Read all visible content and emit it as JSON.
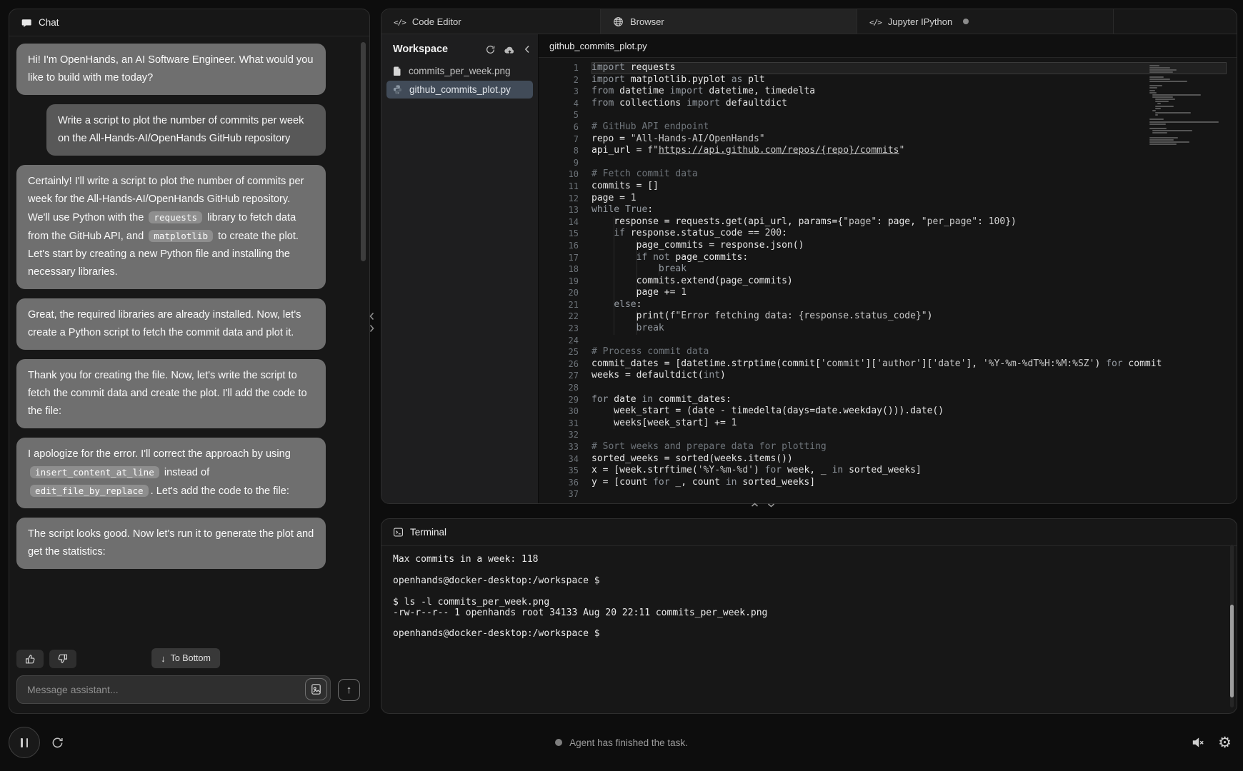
{
  "chat": {
    "title": "Chat",
    "messages": [
      {
        "role": "assistant",
        "parts": [
          {
            "t": "text",
            "v": "Hi! I'm OpenHands, an AI Software Engineer. What would you like to build with me today?"
          }
        ]
      },
      {
        "role": "user",
        "parts": [
          {
            "t": "text",
            "v": "Write a script to plot the number of commits per week on the All-Hands-AI/OpenHands GitHub repository"
          }
        ]
      },
      {
        "role": "assistant",
        "parts": [
          {
            "t": "text",
            "v": "Certainly! I'll write a script to plot the number of commits per week for the All-Hands-AI/OpenHands GitHub repository. We'll use Python with the "
          },
          {
            "t": "code",
            "v": "requests"
          },
          {
            "t": "text",
            "v": " library to fetch data from the GitHub API, and "
          },
          {
            "t": "code",
            "v": "matplotlib"
          },
          {
            "t": "text",
            "v": " to create the plot. Let's start by creating a new Python file and installing the necessary libraries."
          }
        ]
      },
      {
        "role": "assistant",
        "parts": [
          {
            "t": "text",
            "v": "Great, the required libraries are already installed. Now, let's create a Python script to fetch the commit data and plot it."
          }
        ]
      },
      {
        "role": "assistant",
        "parts": [
          {
            "t": "text",
            "v": "Thank you for creating the file. Now, let's write the script to fetch the commit data and create the plot. I'll add the code to the file:"
          }
        ]
      },
      {
        "role": "assistant",
        "parts": [
          {
            "t": "text",
            "v": "I apologize for the error. I'll correct the approach by using "
          },
          {
            "t": "code",
            "v": "insert_content_at_line"
          },
          {
            "t": "text",
            "v": " instead of "
          },
          {
            "t": "code",
            "v": "edit_file_by_replace"
          },
          {
            "t": "text",
            "v": ". Let's add the code to the file:"
          }
        ]
      },
      {
        "role": "assistant",
        "parts": [
          {
            "t": "text",
            "v": "The script looks good. Now let's run it to generate the plot and get the statistics:"
          }
        ]
      }
    ],
    "to_bottom_label": "To Bottom",
    "input_placeholder": "Message assistant...",
    "feedback_icons": [
      "thumbs-up-icon",
      "thumbs-down-icon"
    ],
    "input_icons": [
      "attach-image-icon",
      "send-up-arrow-icon"
    ]
  },
  "tabs": [
    {
      "id": "code-editor",
      "label": "Code Editor",
      "icon": "code-icon",
      "dot": false
    },
    {
      "id": "browser",
      "label": "Browser",
      "icon": "globe-icon",
      "dot": false
    },
    {
      "id": "jupyter",
      "label": "Jupyter IPython",
      "icon": "code-icon",
      "dot": true
    }
  ],
  "workspace": {
    "title": "Workspace",
    "toolbar_icons": [
      "refresh-icon",
      "cloud-upload-icon",
      "collapse-left-icon"
    ],
    "files": [
      {
        "name": "commits_per_week.png",
        "icon": "image-file-icon",
        "selected": false
      },
      {
        "name": "github_commits_plot.py",
        "icon": "python-file-icon",
        "selected": true
      }
    ]
  },
  "editor": {
    "open_file": "github_commits_plot.py",
    "lines": [
      {
        "n": 1,
        "cur": true,
        "t": [
          [
            "kw",
            "import"
          ],
          [
            "pl",
            " requests"
          ]
        ]
      },
      {
        "n": 2,
        "t": [
          [
            "kw",
            "import"
          ],
          [
            "pl",
            " matplotlib.pyplot "
          ],
          [
            "kw",
            "as"
          ],
          [
            "pl",
            " plt"
          ]
        ]
      },
      {
        "n": 3,
        "t": [
          [
            "kw",
            "from"
          ],
          [
            "pl",
            " datetime "
          ],
          [
            "kw",
            "import"
          ],
          [
            "pl",
            " datetime, timedelta"
          ]
        ]
      },
      {
        "n": 4,
        "t": [
          [
            "kw",
            "from"
          ],
          [
            "pl",
            " collections "
          ],
          [
            "kw",
            "import"
          ],
          [
            "pl",
            " defaultdict"
          ]
        ]
      },
      {
        "n": 5,
        "t": []
      },
      {
        "n": 6,
        "t": [
          [
            "com",
            "# GitHub API endpoint"
          ]
        ]
      },
      {
        "n": 7,
        "t": [
          [
            "pl",
            "repo = "
          ],
          [
            "str",
            "\"All-Hands-AI/OpenHands\""
          ]
        ]
      },
      {
        "n": 8,
        "t": [
          [
            "pl",
            "api_url = "
          ],
          [
            "str",
            "f\""
          ],
          [
            "url",
            "https://api.github.com/repos/{repo}/commits"
          ],
          [
            "str",
            "\""
          ]
        ]
      },
      {
        "n": 9,
        "t": []
      },
      {
        "n": 10,
        "t": [
          [
            "com",
            "# Fetch commit data"
          ]
        ]
      },
      {
        "n": 11,
        "t": [
          [
            "pl",
            "commits = []"
          ]
        ]
      },
      {
        "n": 12,
        "t": [
          [
            "pl",
            "page = "
          ],
          [
            "num",
            "1"
          ]
        ]
      },
      {
        "n": 13,
        "t": [
          [
            "kw",
            "while"
          ],
          [
            "pl",
            " "
          ],
          [
            "kw",
            "True"
          ],
          [
            "pl",
            ":"
          ]
        ]
      },
      {
        "n": 14,
        "t": [
          [
            "pl",
            "    response = requests.get(api_url, params={"
          ],
          [
            "str",
            "\"page\""
          ],
          [
            "pl",
            ": page, "
          ],
          [
            "str",
            "\"per_page\""
          ],
          [
            "pl",
            ": "
          ],
          [
            "num",
            "100"
          ],
          [
            "pl",
            "})"
          ]
        ]
      },
      {
        "n": 15,
        "t": [
          [
            "pl",
            "    "
          ],
          [
            "kw",
            "if"
          ],
          [
            "pl",
            " response.status_code == "
          ],
          [
            "num",
            "200"
          ],
          [
            "pl",
            ":"
          ]
        ]
      },
      {
        "n": 16,
        "t": [
          [
            "pl",
            "        page_commits = response.json()"
          ]
        ]
      },
      {
        "n": 17,
        "t": [
          [
            "pl",
            "        "
          ],
          [
            "kw",
            "if"
          ],
          [
            "pl",
            " "
          ],
          [
            "kw",
            "not"
          ],
          [
            "pl",
            " page_commits:"
          ]
        ]
      },
      {
        "n": 18,
        "t": [
          [
            "pl",
            "            "
          ],
          [
            "kw",
            "break"
          ]
        ]
      },
      {
        "n": 19,
        "t": [
          [
            "pl",
            "        commits.extend(page_commits)"
          ]
        ]
      },
      {
        "n": 20,
        "t": [
          [
            "pl",
            "        page += "
          ],
          [
            "num",
            "1"
          ]
        ]
      },
      {
        "n": 21,
        "t": [
          [
            "pl",
            "    "
          ],
          [
            "kw",
            "else"
          ],
          [
            "pl",
            ":"
          ]
        ]
      },
      {
        "n": 22,
        "t": [
          [
            "pl",
            "        print("
          ],
          [
            "str",
            "f\"Error fetching data: {response.status_code}\""
          ],
          [
            "pl",
            ")"
          ]
        ]
      },
      {
        "n": 23,
        "t": [
          [
            "pl",
            "        "
          ],
          [
            "kw",
            "break"
          ]
        ]
      },
      {
        "n": 24,
        "t": []
      },
      {
        "n": 25,
        "t": [
          [
            "com",
            "# Process commit data"
          ]
        ]
      },
      {
        "n": 26,
        "t": [
          [
            "pl",
            "commit_dates = [datetime.strptime(commit["
          ],
          [
            "str",
            "'commit'"
          ],
          [
            "pl",
            "]["
          ],
          [
            "str",
            "'author'"
          ],
          [
            "pl",
            "]["
          ],
          [
            "str",
            "'date'"
          ],
          [
            "pl",
            "], "
          ],
          [
            "str",
            "'%Y-%m-%dT%H:%M:%SZ'"
          ],
          [
            "pl",
            ") "
          ],
          [
            "kw",
            "for"
          ],
          [
            "pl",
            " commit"
          ]
        ]
      },
      {
        "n": 27,
        "t": [
          [
            "pl",
            "weeks = defaultdict("
          ],
          [
            "kw",
            "int"
          ],
          [
            "pl",
            ")"
          ]
        ]
      },
      {
        "n": 28,
        "t": []
      },
      {
        "n": 29,
        "t": [
          [
            "kw",
            "for"
          ],
          [
            "pl",
            " date "
          ],
          [
            "kw",
            "in"
          ],
          [
            "pl",
            " commit_dates:"
          ]
        ]
      },
      {
        "n": 30,
        "t": [
          [
            "pl",
            "    week_start = (date - timedelta(days=date.weekday())).date()"
          ]
        ]
      },
      {
        "n": 31,
        "t": [
          [
            "pl",
            "    weeks[week_start] += "
          ],
          [
            "num",
            "1"
          ]
        ]
      },
      {
        "n": 32,
        "t": []
      },
      {
        "n": 33,
        "t": [
          [
            "com",
            "# Sort weeks and prepare data for plotting"
          ]
        ]
      },
      {
        "n": 34,
        "t": [
          [
            "pl",
            "sorted_weeks = sorted(weeks.items())"
          ]
        ]
      },
      {
        "n": 35,
        "t": [
          [
            "pl",
            "x = [week.strftime("
          ],
          [
            "str",
            "'%Y-%m-%d'"
          ],
          [
            "pl",
            ") "
          ],
          [
            "kw",
            "for"
          ],
          [
            "pl",
            " week, _ "
          ],
          [
            "kw",
            "in"
          ],
          [
            "pl",
            " sorted_weeks]"
          ]
        ]
      },
      {
        "n": 36,
        "t": [
          [
            "pl",
            "y = [count "
          ],
          [
            "kw",
            "for"
          ],
          [
            "pl",
            " _, count "
          ],
          [
            "kw",
            "in"
          ],
          [
            "pl",
            " sorted_weeks]"
          ]
        ]
      },
      {
        "n": 37,
        "t": []
      }
    ]
  },
  "terminal": {
    "title": "Terminal",
    "lines": [
      "Max commits in a week: 118",
      "",
      "openhands@docker-desktop:/workspace $",
      "",
      "$ ls -l commits_per_week.png",
      "-rw-r--r-- 1 openhands root 34133 Aug 20 22:11 commits_per_week.png",
      "",
      "openhands@docker-desktop:/workspace $"
    ]
  },
  "status_bar": {
    "status_text": "Agent has finished the task.",
    "left_icons": [
      "pause-icon",
      "refresh-icon"
    ],
    "right_icons": [
      "mute-icon",
      "settings-icon"
    ]
  },
  "colors": {
    "assistant_bubble": "#6f6f6f",
    "user_bubble": "#585858",
    "selected_file_bg": "#414b58",
    "card_bg": "#171717",
    "code_bg": "#151515"
  }
}
